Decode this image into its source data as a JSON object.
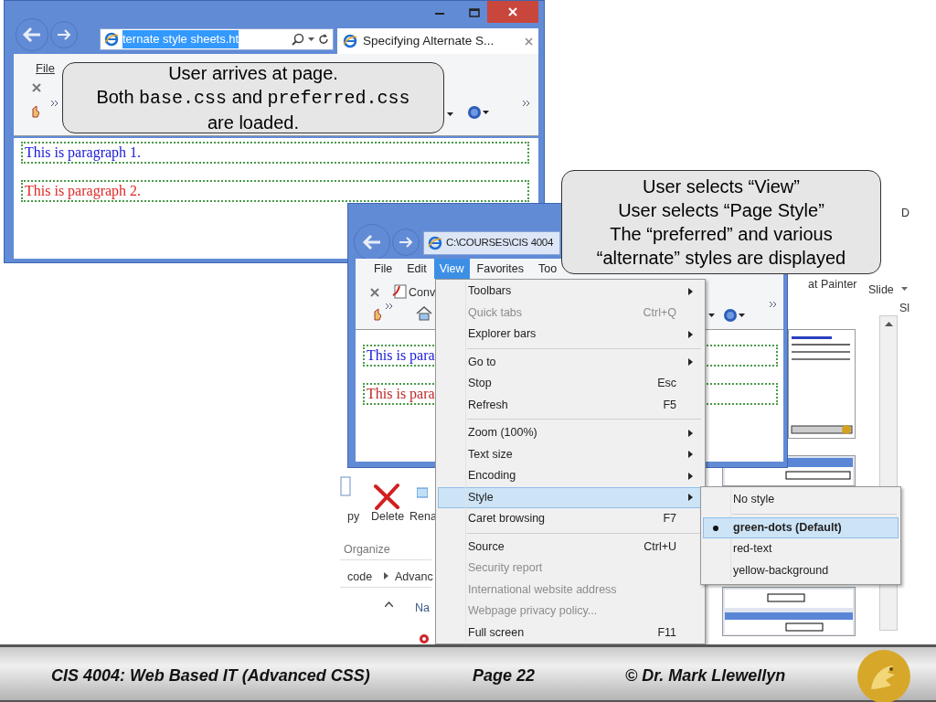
{
  "window_1": {
    "address": "ternate style sheets.ht",
    "address_selected": true,
    "tab_title": "Specifying Alternate S...",
    "menu": [
      "File"
    ],
    "paragraphs": [
      {
        "text": "This is paragraph 1.",
        "color": "#1a1ad8"
      },
      {
        "text": "This is paragraph 2.",
        "color": "#e02828"
      }
    ]
  },
  "callout_1": {
    "lines": [
      [
        {
          "kind": "text",
          "text": "User arrives at page."
        }
      ],
      [
        {
          "kind": "text",
          "text": "Both "
        },
        {
          "kind": "code",
          "text": "base.css"
        },
        {
          "kind": "text",
          "text": " and "
        },
        {
          "kind": "code",
          "text": "preferred.css"
        }
      ],
      [
        {
          "kind": "text",
          "text": "are loaded."
        }
      ]
    ]
  },
  "background_app": {
    "ribbon": [
      "D",
      "at Painter",
      "Slide",
      "Sl"
    ],
    "explorer_buttons": [
      "py",
      "Delete",
      "Rena"
    ],
    "explorer_group": "Organize",
    "breadcrumb": [
      "code",
      "Advanc"
    ],
    "column_header": "Na"
  },
  "window_2": {
    "address": "C:\\COURSES\\CIS 4004",
    "toolbar_text": "Conv",
    "menu": [
      {
        "label": "File",
        "selected": false
      },
      {
        "label": "Edit",
        "selected": false
      },
      {
        "label": "View",
        "selected": true
      },
      {
        "label": "Favorites",
        "selected": false
      },
      {
        "label": "Too",
        "selected": false
      }
    ],
    "paragraphs": [
      {
        "text": "This is para",
        "color": "#1a1ad8"
      },
      {
        "text": "This is para",
        "color": "#c02828"
      }
    ]
  },
  "view_menu": {
    "items": [
      {
        "kind": "item",
        "label": "Toolbars",
        "submenu": true,
        "disabled": false,
        "selected": false
      },
      {
        "kind": "item",
        "label": "Quick tabs",
        "shortcut": "Ctrl+Q",
        "submenu": false,
        "disabled": true,
        "selected": false
      },
      {
        "kind": "item",
        "label": "Explorer bars",
        "submenu": true,
        "disabled": false,
        "selected": false
      },
      {
        "kind": "separator"
      },
      {
        "kind": "item",
        "label": "Go to",
        "submenu": true,
        "disabled": false,
        "selected": false
      },
      {
        "kind": "item",
        "label": "Stop",
        "shortcut": "Esc",
        "submenu": false,
        "disabled": false,
        "selected": false
      },
      {
        "kind": "item",
        "label": "Refresh",
        "shortcut": "F5",
        "submenu": false,
        "disabled": false,
        "selected": false
      },
      {
        "kind": "separator"
      },
      {
        "kind": "item",
        "label": "Zoom (100%)",
        "submenu": true,
        "disabled": false,
        "selected": false
      },
      {
        "kind": "item",
        "label": "Text size",
        "submenu": true,
        "disabled": false,
        "selected": false
      },
      {
        "kind": "item",
        "label": "Encoding",
        "submenu": true,
        "disabled": false,
        "selected": false
      },
      {
        "kind": "item",
        "label": "Style",
        "submenu": true,
        "disabled": false,
        "selected": true
      },
      {
        "kind": "item",
        "label": "Caret browsing",
        "shortcut": "F7",
        "submenu": false,
        "disabled": false,
        "selected": false
      },
      {
        "kind": "separator"
      },
      {
        "kind": "item",
        "label": "Source",
        "shortcut": "Ctrl+U",
        "submenu": false,
        "disabled": false,
        "selected": false
      },
      {
        "kind": "item",
        "label": "Security report",
        "submenu": false,
        "disabled": true,
        "selected": false
      },
      {
        "kind": "item",
        "label": "International website address",
        "submenu": false,
        "disabled": true,
        "selected": false
      },
      {
        "kind": "item",
        "label": "Webpage privacy policy...",
        "submenu": false,
        "disabled": true,
        "selected": false
      },
      {
        "kind": "item",
        "label": "Full screen",
        "shortcut": "F11",
        "submenu": false,
        "disabled": false,
        "selected": false
      }
    ]
  },
  "style_menu": {
    "items": [
      {
        "kind": "item",
        "label": "No style",
        "selected": false
      },
      {
        "kind": "separator"
      },
      {
        "kind": "item",
        "label": "green-dots (Default)",
        "selected": true
      },
      {
        "kind": "item",
        "label": "red-text",
        "selected": false
      },
      {
        "kind": "item",
        "label": "yellow-background",
        "selected": false
      }
    ]
  },
  "callout_2": {
    "lines": [
      [
        {
          "kind": "text",
          "text": "User selects “View”"
        }
      ],
      [
        {
          "kind": "text",
          "text": "User selects “Page Style”"
        }
      ],
      [
        {
          "kind": "text",
          "text": "The “preferred” and various"
        }
      ],
      [
        {
          "kind": "text",
          "text": "“alternate” styles are displayed"
        }
      ]
    ]
  },
  "footer": {
    "course": "CIS 4004: Web Based IT (Advanced CSS)",
    "page": "Page 22",
    "author": "© Dr. Mark Llewellyn"
  }
}
